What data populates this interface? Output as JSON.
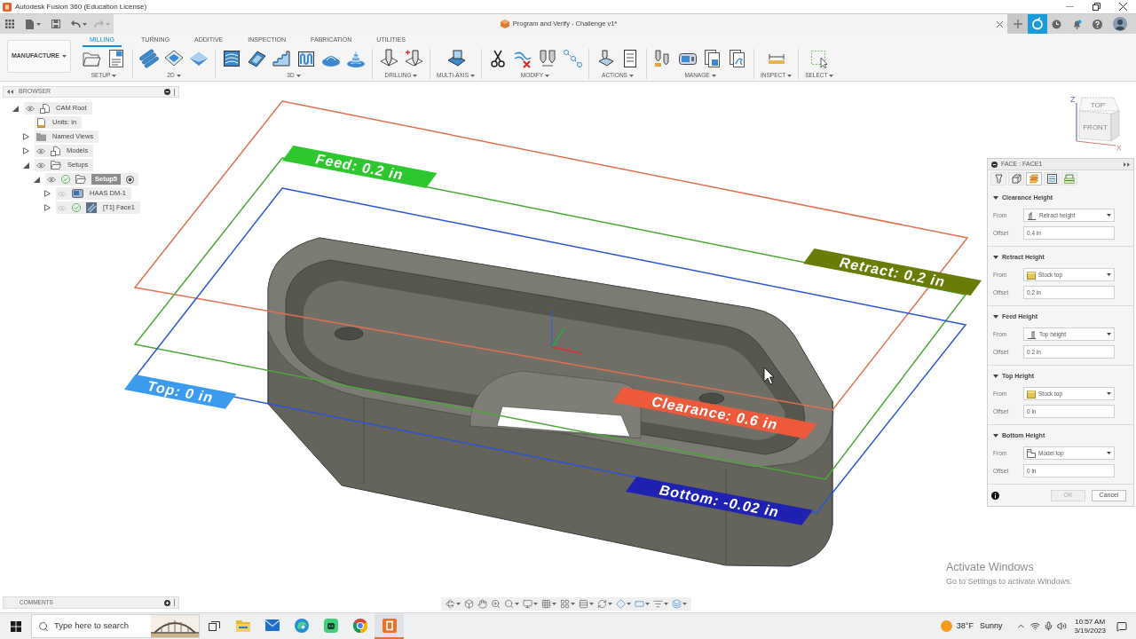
{
  "window": {
    "title": "Autodesk Fusion 360 (Education License)"
  },
  "quick_access": [
    {
      "kind": "undo",
      "disabled": false
    },
    {
      "kind": "redo",
      "disabled": true
    }
  ],
  "document_tab": {
    "title": "Program and Verify - Challenge v1*"
  },
  "ribbon": {
    "workspace": "MANUFACTURE",
    "tabs": [
      {
        "label": "MILLING",
        "selected": true
      },
      {
        "label": "TURNING",
        "selected": false
      },
      {
        "label": "ADDITIVE",
        "selected": false
      },
      {
        "label": "INSPECTION",
        "selected": false
      },
      {
        "label": "FABRICATION",
        "selected": false
      },
      {
        "label": "UTILITIES",
        "selected": false
      }
    ],
    "groups": [
      {
        "kind": "setup",
        "label": "SETUP"
      },
      {
        "kind": "planar",
        "label": "2D"
      },
      {
        "kind": "surface",
        "label": "3D"
      },
      {
        "kind": "drilling",
        "label": "DRILLING"
      },
      {
        "kind": "multiaxis",
        "label": "MULTI-AXIS"
      },
      {
        "kind": "modify",
        "label": "MODIFY"
      },
      {
        "kind": "actions",
        "label": "ACTIONS"
      },
      {
        "kind": "manage",
        "label": "MANAGE"
      },
      {
        "kind": "inspect",
        "label": "INSPECT"
      },
      {
        "kind": "select",
        "label": "SELECT"
      }
    ]
  },
  "browser": {
    "title": "BROWSER",
    "items": [
      {
        "kind": "root",
        "label": "CAM Root",
        "expanded": true,
        "visible": true,
        "selected": false,
        "children": [
          {
            "kind": "units",
            "label": "Units: in",
            "selected": false
          },
          {
            "kind": "views",
            "label": "Named Views",
            "expanded": false,
            "selected": false
          },
          {
            "kind": "models",
            "label": "Models",
            "expanded": false,
            "visible": true,
            "selected": false
          },
          {
            "kind": "setups",
            "label": "Setups",
            "expanded": true,
            "visible": true,
            "selected": false,
            "children": [
              {
                "kind": "setup",
                "label": "Setup5",
                "expanded": true,
                "visible": true,
                "valid": true,
                "active": true,
                "selected": true,
                "children": [
                  {
                    "kind": "machine",
                    "label": "HAAS DM-1",
                    "expanded": false,
                    "visible": false,
                    "selected": false
                  },
                  {
                    "kind": "operation",
                    "label": "[T1] Face1",
                    "expanded": false,
                    "visible": false,
                    "valid": true,
                    "selected": false
                  }
                ]
              }
            ]
          }
        ]
      }
    ]
  },
  "viewport": {
    "planes": [
      {
        "color": "#e2704e"
      },
      {
        "color": "#4aa836"
      },
      {
        "color": "#2b55d8"
      }
    ],
    "height_labels": [
      {
        "text": "Feed: 0.2 in",
        "color": "#2fc72f"
      },
      {
        "text": "Retract: 0.2 in",
        "color": "#6b7c06"
      },
      {
        "text": "Top: 0 in",
        "color": "#3a9bef"
      },
      {
        "text": "Clearance: 0.6 in",
        "color": "#ec5a3b"
      },
      {
        "text": "Bottom: -0.02 in",
        "color": "#1f22b0"
      }
    ]
  },
  "view_cube": {
    "top": "TOP",
    "front": "FRONT",
    "z": "Z",
    "x": "X"
  },
  "dialog": {
    "title": "FACE : FACE1",
    "tabs": [
      {
        "kind": "tool",
        "selected": false
      },
      {
        "kind": "geometry",
        "selected": false
      },
      {
        "kind": "heights",
        "selected": true
      },
      {
        "kind": "passes",
        "selected": false
      },
      {
        "kind": "linking",
        "selected": false
      }
    ],
    "sections": [
      {
        "title": "Clearance Height",
        "expanded": true,
        "from_label": "From",
        "from": {
          "kind": "retract",
          "value": "Retract height"
        },
        "offset_label": "Offset",
        "offset": "0.4 in"
      },
      {
        "title": "Retract Height",
        "expanded": true,
        "from_label": "From",
        "from": {
          "kind": "stock",
          "value": "Stock top"
        },
        "offset_label": "Offset",
        "offset": "0.2 in"
      },
      {
        "title": "Feed Height",
        "expanded": true,
        "from_label": "From",
        "from": {
          "kind": "top",
          "value": "Top height"
        },
        "offset_label": "Offset",
        "offset": "0.2 in"
      },
      {
        "title": "Top Height",
        "expanded": true,
        "from_label": "From",
        "from": {
          "kind": "stock",
          "value": "Stock top"
        },
        "offset_label": "Offset",
        "offset": "0 in"
      },
      {
        "title": "Bottom Height",
        "expanded": true,
        "from_label": "From",
        "from": {
          "kind": "model",
          "value": "Model top"
        },
        "offset_label": "Offset",
        "offset": "0 in"
      }
    ],
    "buttons": [
      {
        "label": "OK",
        "disabled": true
      },
      {
        "label": "Cancel",
        "disabled": false
      }
    ]
  },
  "comments": {
    "title": "COMMENTS"
  },
  "activation_notice": {
    "title": "Activate Windows",
    "text": "Go to Settings to activate Windows."
  },
  "taskbar": {
    "search": {
      "placeholder": "Type here to search"
    },
    "apps": [
      {
        "kind": "explorer",
        "selected": false
      },
      {
        "kind": "mail",
        "selected": false
      },
      {
        "kind": "edge",
        "selected": false
      },
      {
        "kind": "robot",
        "selected": false
      },
      {
        "kind": "chrome",
        "selected": false
      },
      {
        "kind": "fusion",
        "selected": true
      }
    ],
    "weather": {
      "temperature": "38°F",
      "condition": "Sunny"
    },
    "time": "10:57 AM",
    "date": "3/19/2023"
  }
}
